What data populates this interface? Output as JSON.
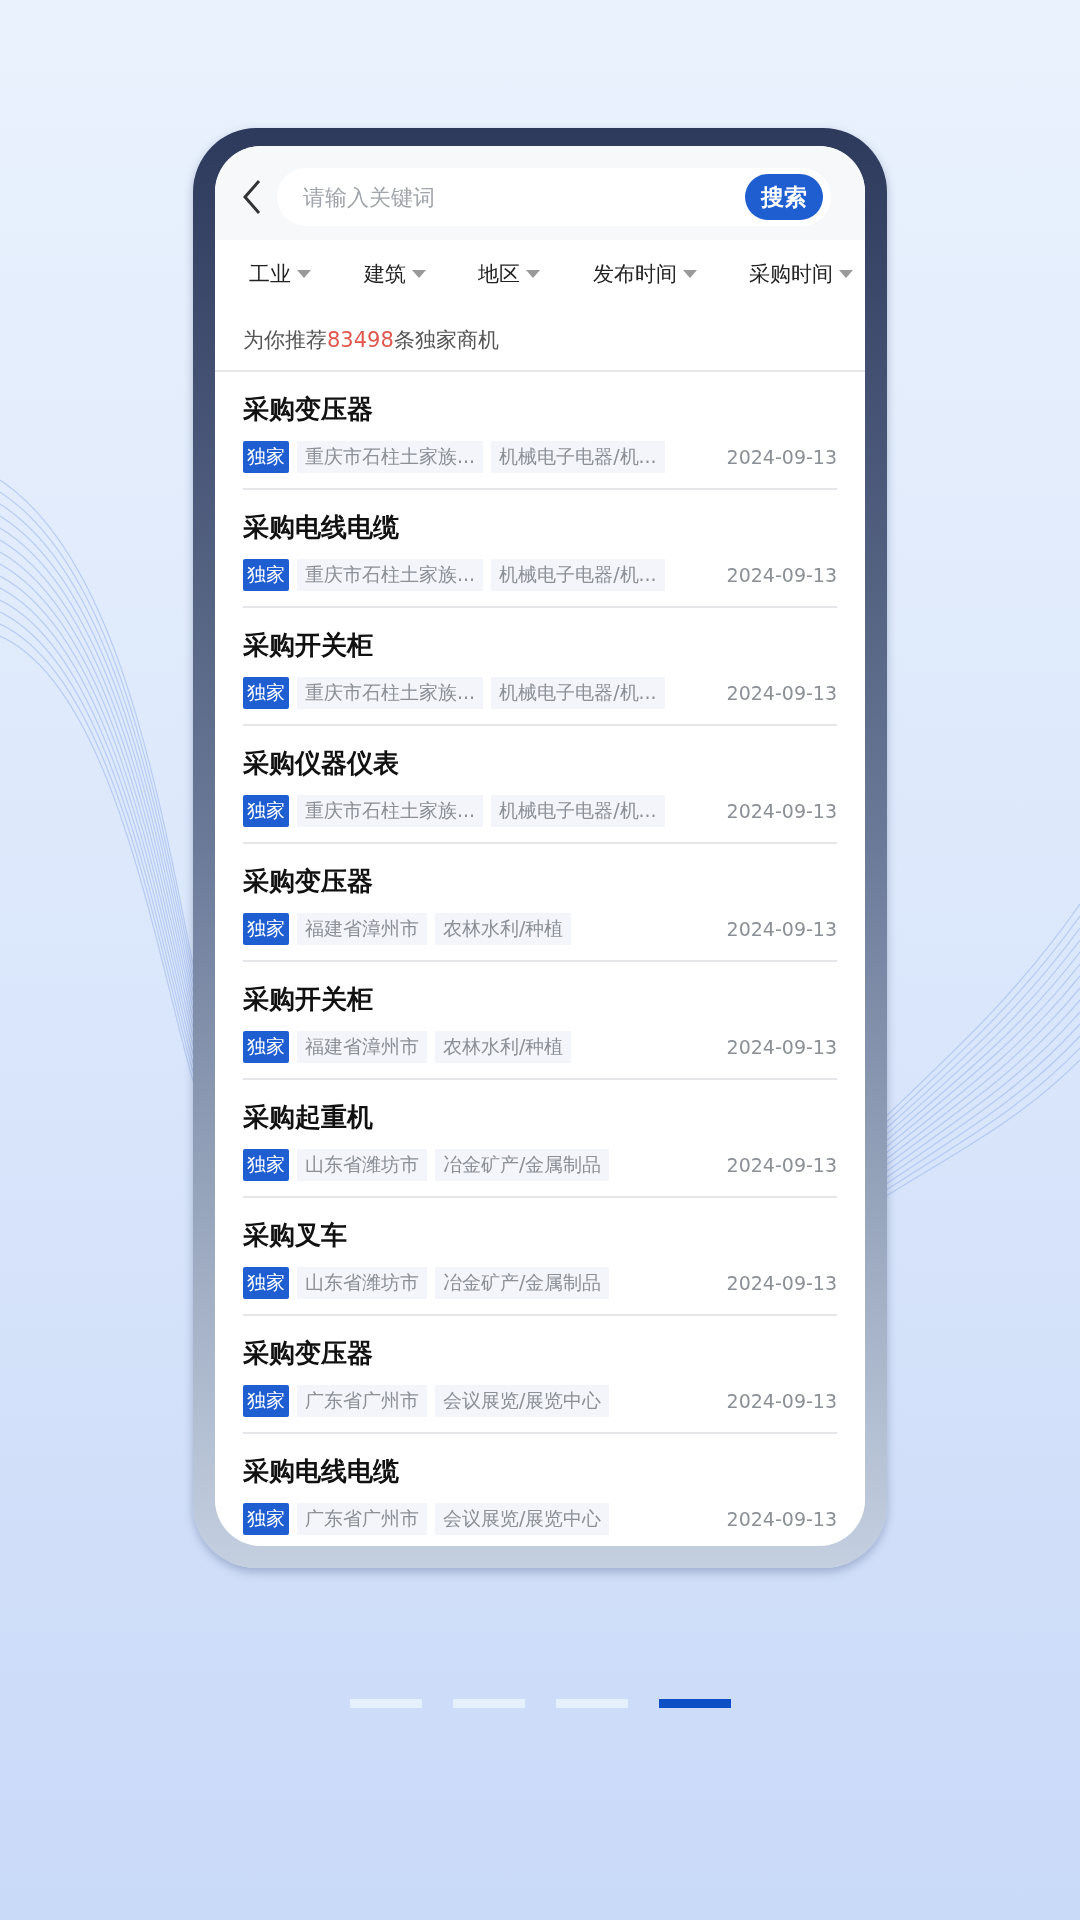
{
  "search": {
    "placeholder": "请输入关键词",
    "button": "搜索"
  },
  "filters": [
    {
      "label": "工业"
    },
    {
      "label": "建筑"
    },
    {
      "label": "地区"
    },
    {
      "label": "发布时间"
    },
    {
      "label": "采购时间"
    }
  ],
  "summary": {
    "prefix": "为你推荐",
    "count": "83498",
    "suffix": "条独家商机"
  },
  "items": [
    {
      "title": "采购变压器",
      "badge": "独家",
      "region": "重庆市石柱土家族...",
      "category": "机械电子电器/机...",
      "date": "2024-09-13"
    },
    {
      "title": "采购电线电缆",
      "badge": "独家",
      "region": "重庆市石柱土家族...",
      "category": "机械电子电器/机...",
      "date": "2024-09-13"
    },
    {
      "title": "采购开关柜",
      "badge": "独家",
      "region": "重庆市石柱土家族...",
      "category": "机械电子电器/机...",
      "date": "2024-09-13"
    },
    {
      "title": "采购仪器仪表",
      "badge": "独家",
      "region": "重庆市石柱土家族...",
      "category": "机械电子电器/机...",
      "date": "2024-09-13"
    },
    {
      "title": "采购变压器",
      "badge": "独家",
      "region": "福建省漳州市",
      "category": "农林水利/种植",
      "date": "2024-09-13"
    },
    {
      "title": "采购开关柜",
      "badge": "独家",
      "region": "福建省漳州市",
      "category": "农林水利/种植",
      "date": "2024-09-13"
    },
    {
      "title": "采购起重机",
      "badge": "独家",
      "region": "山东省潍坊市",
      "category": "冶金矿产/金属制品",
      "date": "2024-09-13"
    },
    {
      "title": "采购叉车",
      "badge": "独家",
      "region": "山东省潍坊市",
      "category": "冶金矿产/金属制品",
      "date": "2024-09-13"
    },
    {
      "title": "采购变压器",
      "badge": "独家",
      "region": "广东省广州市",
      "category": "会议展览/展览中心",
      "date": "2024-09-13"
    },
    {
      "title": "采购电线电缆",
      "badge": "独家",
      "region": "广东省广州市",
      "category": "会议展览/展览中心",
      "date": "2024-09-13"
    }
  ],
  "pager": [
    {
      "selected": false
    },
    {
      "selected": false
    },
    {
      "selected": false
    },
    {
      "selected": true
    }
  ]
}
